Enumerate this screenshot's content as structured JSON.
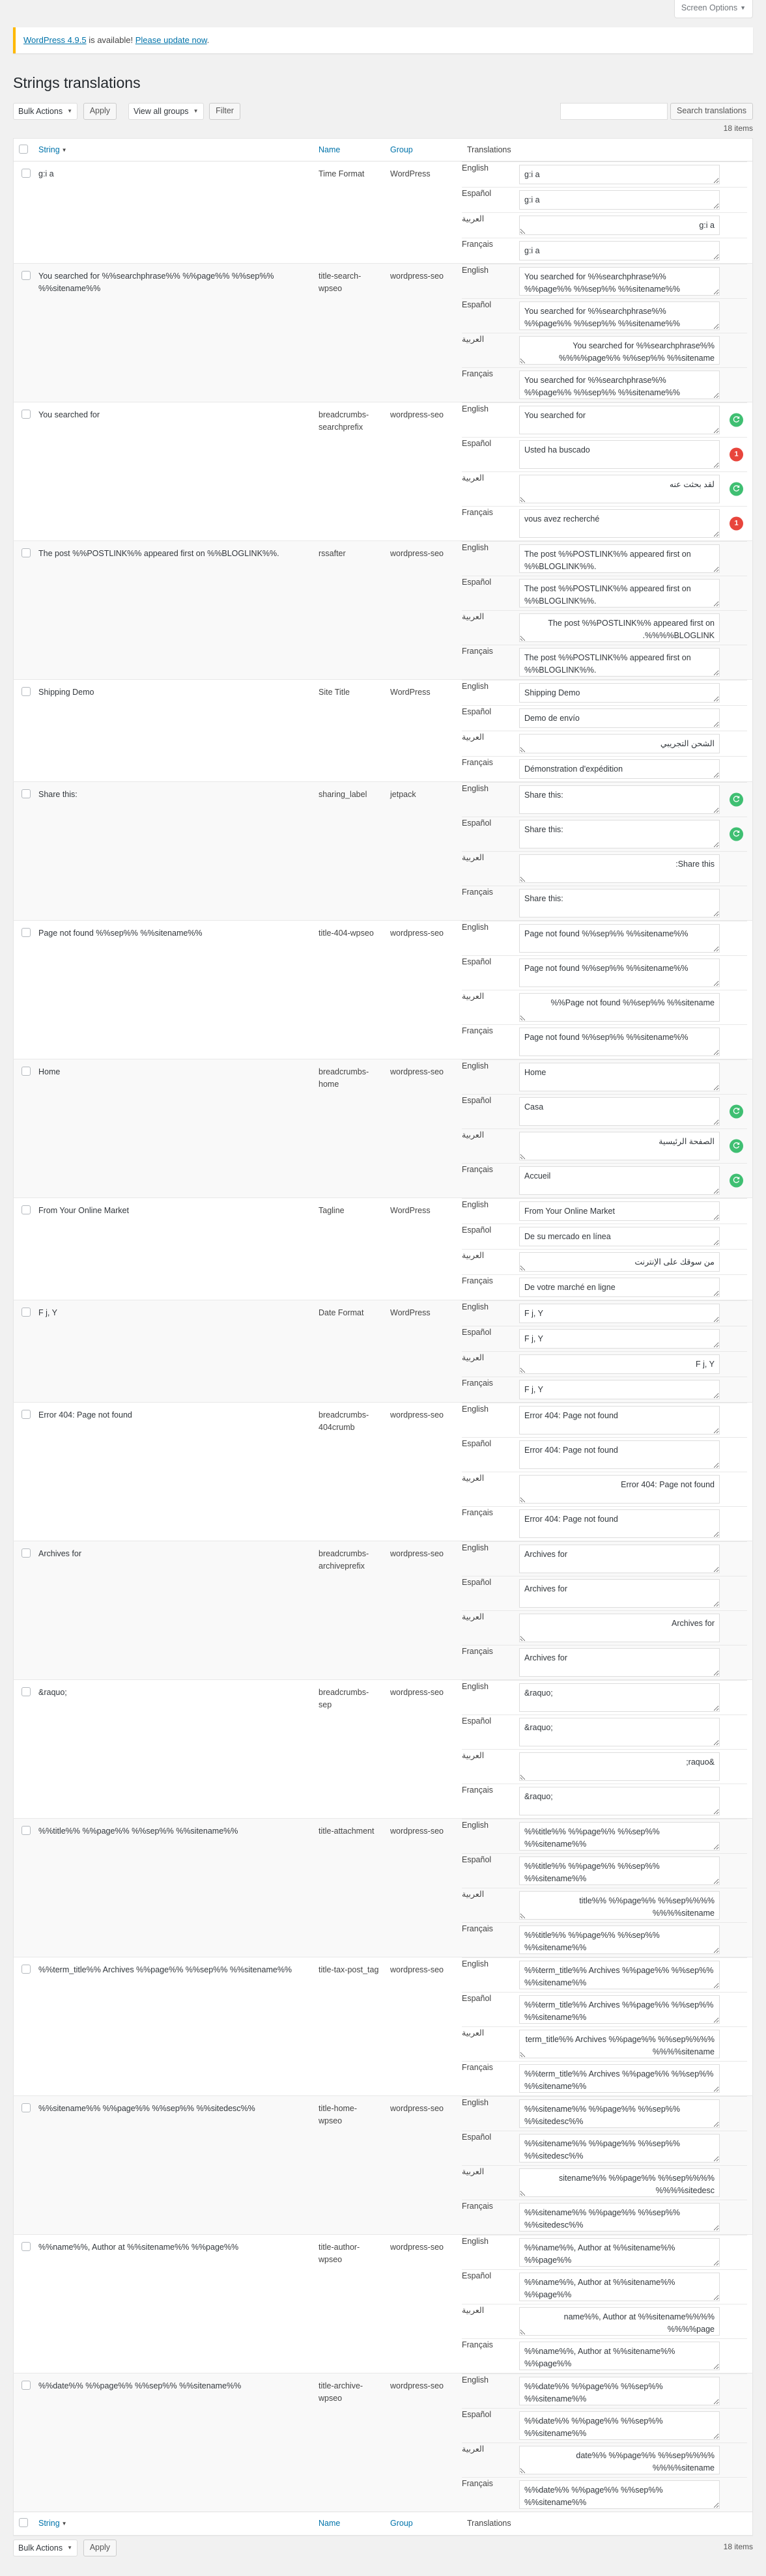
{
  "screen_options": {
    "label": "Screen Options",
    "caret": "▼"
  },
  "notice": {
    "link1": "WordPress 4.9.5",
    "mid": " is available! ",
    "link2": "Please update now",
    "end": "."
  },
  "page_title": "Strings translations",
  "toolbar": {
    "bulk_actions": "Bulk Actions",
    "apply": "Apply",
    "view_groups": "View all groups",
    "filter": "Filter",
    "search_button": "Search translations",
    "search_value": "",
    "items_count": "18 items",
    "caret": "▼"
  },
  "columns": {
    "string": "String",
    "name": "Name",
    "group": "Group",
    "translations": "Translations"
  },
  "languages": [
    "English",
    "Español",
    "العربية",
    "Français"
  ],
  "rows": [
    {
      "string": "g:i a",
      "name": "Time Format",
      "group": "WordPress",
      "size": "h1",
      "translations": [
        "g:i a",
        "g:i a",
        "g:i a",
        "g:i a"
      ],
      "badges": [
        null,
        null,
        null,
        null
      ]
    },
    {
      "string": "You searched for %%searchphrase%% %%page%% %%sep%% %%sitename%%",
      "name": "title-search-wpseo",
      "group": "wordpress-seo",
      "size": "h2",
      "translations": [
        "You searched for %%searchphrase%% %%page%% %%sep%% %%sitename%%",
        "You searched for %%searchphrase%% %%page%% %%sep%% %%sitename%%",
        "You searched for %%searchphrase%% %%page%% %%sep%% %%sitename%%",
        "You searched for %%searchphrase%% %%page%% %%sep%% %%sitename%%"
      ],
      "badges": [
        null,
        null,
        null,
        null
      ]
    },
    {
      "string": "You searched for",
      "name": "breadcrumbs-searchprefix",
      "group": "wordpress-seo",
      "size": "h2",
      "translations": [
        "You searched for",
        "Usted ha buscado",
        "لقد بحثت عنه",
        "vous avez recherché"
      ],
      "badges": [
        "green",
        "red",
        "green",
        "red"
      ],
      "badge_counts": [
        null,
        "1",
        null,
        "1"
      ],
      "annotate": {
        "top": 0.33,
        "height": 0.67
      }
    },
    {
      "string": "The post %%POSTLINK%% appeared first on %%BLOGLINK%%.",
      "name": "rssafter",
      "group": "wordpress-seo",
      "size": "h2",
      "translations": [
        "The post %%POSTLINK%% appeared first on %%BLOGLINK%%.",
        "The post %%POSTLINK%% appeared first on %%BLOGLINK%%.",
        "The post %%POSTLINK%% appeared first on %%BLOGLINK%%.",
        "The post %%POSTLINK%% appeared first on %%BLOGLINK%%."
      ],
      "badges": [
        null,
        null,
        null,
        null
      ]
    },
    {
      "string": "Shipping Demo",
      "name": "Site Title",
      "group": "WordPress",
      "size": "h1",
      "translations": [
        "Shipping Demo",
        "Demo de envío",
        "الشحن التجريبي",
        "Démonstration d'expédition"
      ],
      "badges": [
        null,
        null,
        null,
        null
      ],
      "annotate_full": true
    },
    {
      "string": "Share this:",
      "name": "sharing_label",
      "group": "jetpack",
      "size": "h2",
      "translations": [
        "Share this:",
        "Share this:",
        "Share this:",
        "Share this:"
      ],
      "badges": [
        "green",
        "green",
        null,
        null
      ]
    },
    {
      "string": "Page not found %%sep%% %%sitename%%",
      "name": "title-404-wpseo",
      "group": "wordpress-seo",
      "size": "h2",
      "translations": [
        "Page not found %%sep%% %%sitename%%",
        "Page not found %%sep%% %%sitename%%",
        "Page not found %%sep%% %%sitename%%",
        "Page not found %%sep%% %%sitename%%"
      ],
      "badges": [
        null,
        null,
        null,
        null
      ]
    },
    {
      "string": "Home",
      "name": "breadcrumbs-home",
      "group": "wordpress-seo",
      "size": "h2",
      "translations": [
        "Home",
        "Casa",
        "الصفحة الرئيسية",
        "Accueil"
      ],
      "badges": [
        null,
        "green",
        "green",
        "green"
      ],
      "annotate": {
        "top": 0.29,
        "height": 0.71
      }
    },
    {
      "string": "From Your Online Market",
      "name": "Tagline",
      "group": "WordPress",
      "size": "h1",
      "translations": [
        "From Your Online Market",
        "De su mercado en línea",
        "من سوقك على الإنترنت",
        "De votre marché en ligne"
      ],
      "badges": [
        null,
        null,
        null,
        null
      ],
      "annotate_full": true
    },
    {
      "string": "F j, Y",
      "name": "Date Format",
      "group": "WordPress",
      "size": "h1",
      "translations": [
        "F j, Y",
        "F j, Y",
        "F j, Y",
        "F j, Y"
      ],
      "badges": [
        null,
        null,
        null,
        null
      ]
    },
    {
      "string": "Error 404: Page not found",
      "name": "breadcrumbs-404crumb",
      "group": "wordpress-seo",
      "size": "h2",
      "translations": [
        "Error 404: Page not found",
        "Error 404: Page not found",
        "Error 404: Page not found",
        "Error 404: Page not found"
      ],
      "badges": [
        null,
        null,
        null,
        null
      ]
    },
    {
      "string": "Archives for",
      "name": "breadcrumbs-archiveprefix",
      "group": "wordpress-seo",
      "size": "h2",
      "translations": [
        "Archives for",
        "Archives for",
        "Archives for",
        "Archives for"
      ],
      "badges": [
        null,
        null,
        null,
        null
      ]
    },
    {
      "string": "&raquo;",
      "name": "breadcrumbs-sep",
      "group": "wordpress-seo",
      "size": "h2",
      "translations": [
        "&raquo;",
        "&raquo;",
        "&raquo;",
        "&raquo;"
      ],
      "badges": [
        null,
        null,
        null,
        null
      ]
    },
    {
      "string": "%%title%% %%page%% %%sep%% %%sitename%%",
      "name": "title-attachment",
      "group": "wordpress-seo",
      "size": "h2",
      "translations": [
        "%%title%% %%page%% %%sep%% %%sitename%%",
        "%%title%% %%page%% %%sep%% %%sitename%%",
        "%%title%% %%page%% %%sep%% %%sitename%%",
        "%%title%% %%page%% %%sep%% %%sitename%%"
      ],
      "badges": [
        null,
        null,
        null,
        null
      ]
    },
    {
      "string": "%%term_title%% Archives %%page%% %%sep%% %%sitename%%",
      "name": "title-tax-post_tag",
      "group": "wordpress-seo",
      "size": "h2",
      "translations": [
        "%%term_title%% Archives %%page%% %%sep%% %%sitename%%",
        "%%term_title%% Archives %%page%% %%sep%% %%sitename%%",
        "%%term_title%% Archives %%page%% %%sep%% %%sitename%%",
        "%%term_title%% Archives %%page%% %%sep%% %%sitename%%"
      ],
      "badges": [
        null,
        null,
        null,
        null
      ]
    },
    {
      "string": "%%sitename%% %%page%% %%sep%% %%sitedesc%%",
      "name": "title-home-wpseo",
      "group": "wordpress-seo",
      "size": "h2",
      "translations": [
        "%%sitename%% %%page%% %%sep%% %%sitedesc%%",
        "%%sitename%% %%page%% %%sep%% %%sitedesc%%",
        "%%sitename%% %%page%% %%sep%% %%sitedesc%%",
        "%%sitename%% %%page%% %%sep%% %%sitedesc%%"
      ],
      "badges": [
        null,
        null,
        null,
        null
      ]
    },
    {
      "string": "%%name%%, Author at %%sitename%% %%page%%",
      "name": "title-author-wpseo",
      "group": "wordpress-seo",
      "size": "h2",
      "translations": [
        "%%name%%, Author at %%sitename%% %%page%%",
        "%%name%%, Author at %%sitename%% %%page%%",
        "%%name%%, Author at %%sitename%% %%page%%",
        "%%name%%, Author at %%sitename%% %%page%%"
      ],
      "badges": [
        null,
        null,
        null,
        null
      ]
    },
    {
      "string": "%%date%% %%page%% %%sep%% %%sitename%%",
      "name": "title-archive-wpseo",
      "group": "wordpress-seo",
      "size": "h2",
      "translations": [
        "%%date%% %%page%% %%sep%% %%sitename%%",
        "%%date%% %%page%% %%sep%% %%sitename%%",
        "%%date%% %%page%% %%sep%% %%sitename%%",
        "%%date%% %%page%% %%sep%% %%sitename%%"
      ],
      "badges": [
        null,
        null,
        null,
        null
      ]
    }
  ],
  "colors": {
    "notice_accent": "#ffb900",
    "link": "#0073aa",
    "annotation": "#e8431f",
    "badge_green": "#3fbf72",
    "badge_red": "#e8453c"
  }
}
